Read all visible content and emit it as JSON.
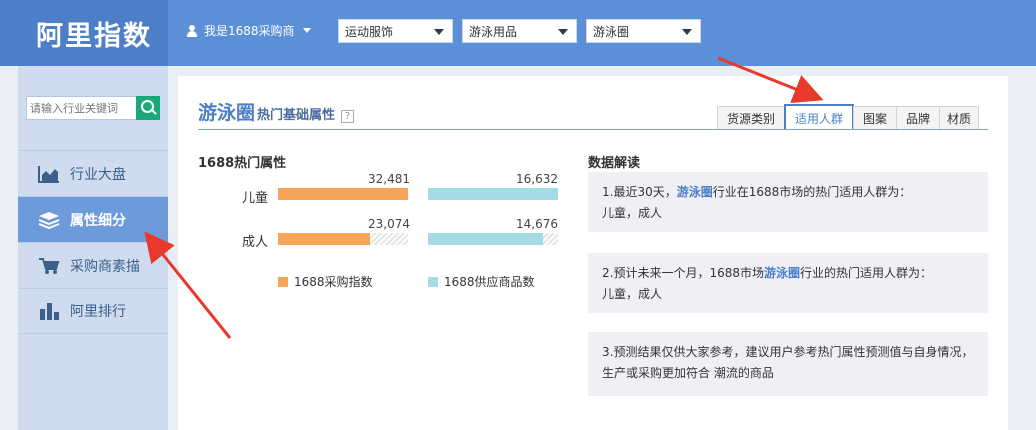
{
  "app": {
    "logo": "阿里指数"
  },
  "header": {
    "user_label": "我是1688采购商",
    "selects": [
      "运动服饰",
      "游泳用品",
      "游泳圈"
    ]
  },
  "sidebar": {
    "search_placeholder": "请输入行业关键词",
    "items": [
      {
        "label": "行业大盘",
        "icon": "area-chart-icon",
        "active": false
      },
      {
        "label": "属性细分",
        "icon": "layers-icon",
        "active": true
      },
      {
        "label": "采购商素描",
        "icon": "cart-icon",
        "active": false
      },
      {
        "label": "阿里排行",
        "icon": "bar-chart-icon",
        "active": false
      }
    ]
  },
  "main": {
    "title_keyword": "游泳圈",
    "title_suffix": "热门基础属性",
    "help": "?",
    "tabs": [
      "货源类别",
      "适用人群",
      "图案",
      "品牌",
      "材质"
    ],
    "active_tab": "适用人群",
    "left_heading": "1688热门属性",
    "right_heading": "数据解读",
    "rows": [
      {
        "label": "儿童",
        "purchase_index": "32,481",
        "supply_count": "16,632"
      },
      {
        "label": "成人",
        "purchase_index": "23,074",
        "supply_count": "14,676"
      }
    ],
    "legend": {
      "purchase": "1688采购指数",
      "supply": "1688供应商品数"
    },
    "insights": [
      {
        "pre": "1.最近30天，",
        "kw": "游泳圈",
        "post": "行业在1688市场的热门适用人群为：",
        "line2": "儿童，成人"
      },
      {
        "pre": "2.预计未来一个月，1688市场",
        "kw": "游泳圈",
        "post": "行业的热门适用人群为：",
        "line2": "儿童，成人"
      },
      {
        "text": "3.预测结果仅供大家参考，建议用户参考热门属性预测值与自身情况，生产或采购更加符合",
        "text_end": "潮流的商品"
      }
    ]
  },
  "chart_data": {
    "type": "bar",
    "categories": [
      "儿童",
      "成人"
    ],
    "series": [
      {
        "name": "1688采购指数",
        "values": [
          32481,
          23074
        ]
      },
      {
        "name": "1688供应商品数",
        "values": [
          16632,
          14676
        ]
      }
    ]
  },
  "colors": {
    "purchase": "#f5a55a",
    "supply": "#a4dbe4",
    "brand": "#4d7fc8",
    "header": "#5b8fd6"
  }
}
